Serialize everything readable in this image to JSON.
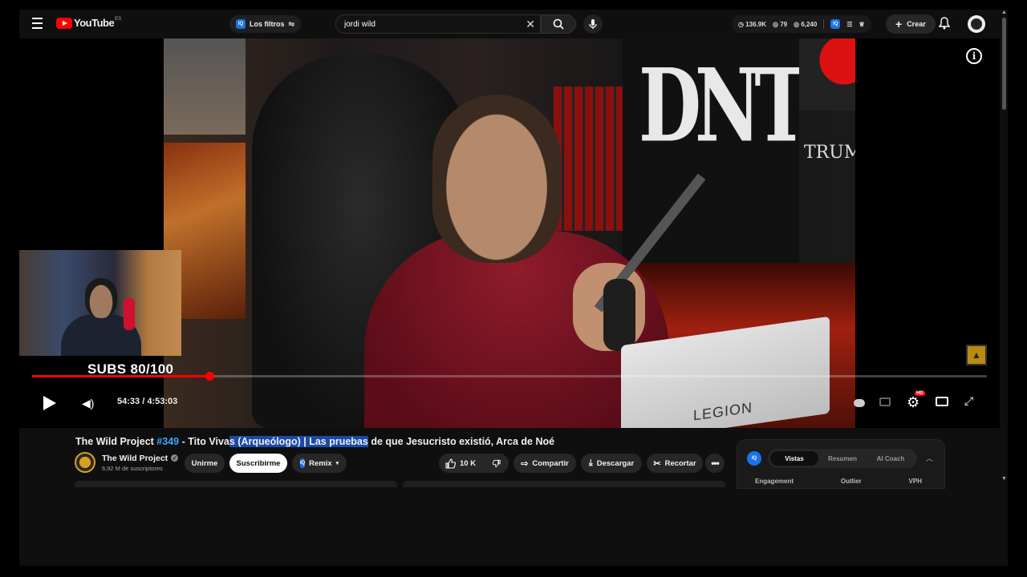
{
  "topbar": {
    "logo_text": "YouTube",
    "logo_region": "ES",
    "filters_badge": "IQ",
    "filters_label": "Los filtros",
    "search_value": "jordi wild",
    "stats": {
      "views": "136.9K",
      "watching": "79",
      "other": "6,240"
    },
    "stats_badge": "IQ",
    "create_label": "Crear"
  },
  "player": {
    "video_laptop_brand": "LEGION",
    "video_shirt_text": "TRUMP",
    "overlay_subs": "SUBS 80/100",
    "time_current": "54:33",
    "time_separator": " / ",
    "time_total": "4:53:03",
    "hd_badge": "HD",
    "progress_fraction": 0.186
  },
  "video": {
    "title_prefix": "The Wild Project ",
    "title_tag": "#349",
    "title_mid": " - Tito Viva",
    "title_hl": "s (Arqueólogo) | Las pruebas",
    "title_suffix": " de que Jesucristo existió, Arca de Noé",
    "channel_name": "The Wild Project",
    "channel_subs": "6,92 M de suscriptores",
    "join_label": "Unirme",
    "subscribe_label": "Suscribirme",
    "remix_badge": "IQ",
    "remix_label": "Remix",
    "likes": "10 K",
    "share_label": "Compartir",
    "download_label": "Descargar",
    "clip_label": "Recortar"
  },
  "panel": {
    "badge": "IQ",
    "tabs": [
      "Vistas",
      "Resumen",
      "AI Coach"
    ],
    "metrics": [
      "Engagement",
      "Outlier",
      "VPH"
    ]
  },
  "colors": {
    "accent_red": "#ff0000",
    "link_blue": "#3ea6ff",
    "highlight": "#1a4aa8",
    "iq_blue": "#1a73e8"
  }
}
